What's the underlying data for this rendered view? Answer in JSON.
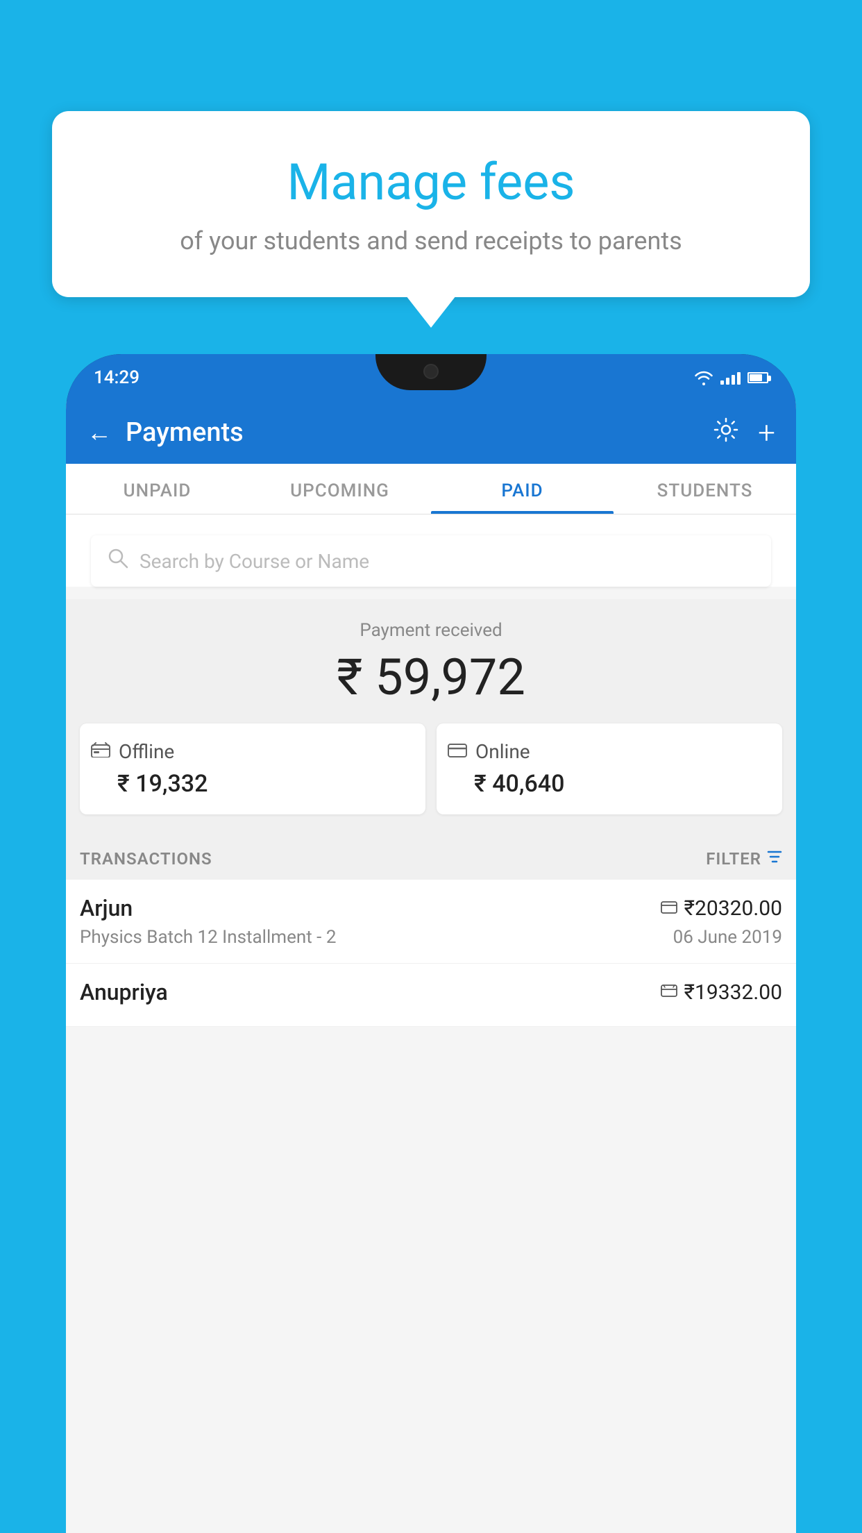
{
  "background_color": "#1ab3e8",
  "speech_bubble": {
    "title": "Manage fees",
    "subtitle": "of your students and send receipts to parents"
  },
  "status_bar": {
    "time": "14:29"
  },
  "header": {
    "title": "Payments",
    "back_label": "←",
    "settings_label": "⚙",
    "add_label": "+"
  },
  "tabs": [
    {
      "id": "unpaid",
      "label": "UNPAID",
      "active": false
    },
    {
      "id": "upcoming",
      "label": "UPCOMING",
      "active": false
    },
    {
      "id": "paid",
      "label": "PAID",
      "active": true
    },
    {
      "id": "students",
      "label": "STUDENTS",
      "active": false
    }
  ],
  "search": {
    "placeholder": "Search by Course or Name"
  },
  "payment_summary": {
    "label": "Payment received",
    "total_amount": "₹ 59,972",
    "offline": {
      "type": "Offline",
      "amount": "₹ 19,332"
    },
    "online": {
      "type": "Online",
      "amount": "₹ 40,640"
    }
  },
  "transactions": {
    "section_label": "TRANSACTIONS",
    "filter_label": "FILTER",
    "items": [
      {
        "name": "Arjun",
        "course": "Physics Batch 12 Installment - 2",
        "amount": "₹20320.00",
        "date": "06 June 2019",
        "payment_type": "online"
      },
      {
        "name": "Anupriya",
        "course": "",
        "amount": "₹19332.00",
        "date": "",
        "payment_type": "offline"
      }
    ]
  }
}
